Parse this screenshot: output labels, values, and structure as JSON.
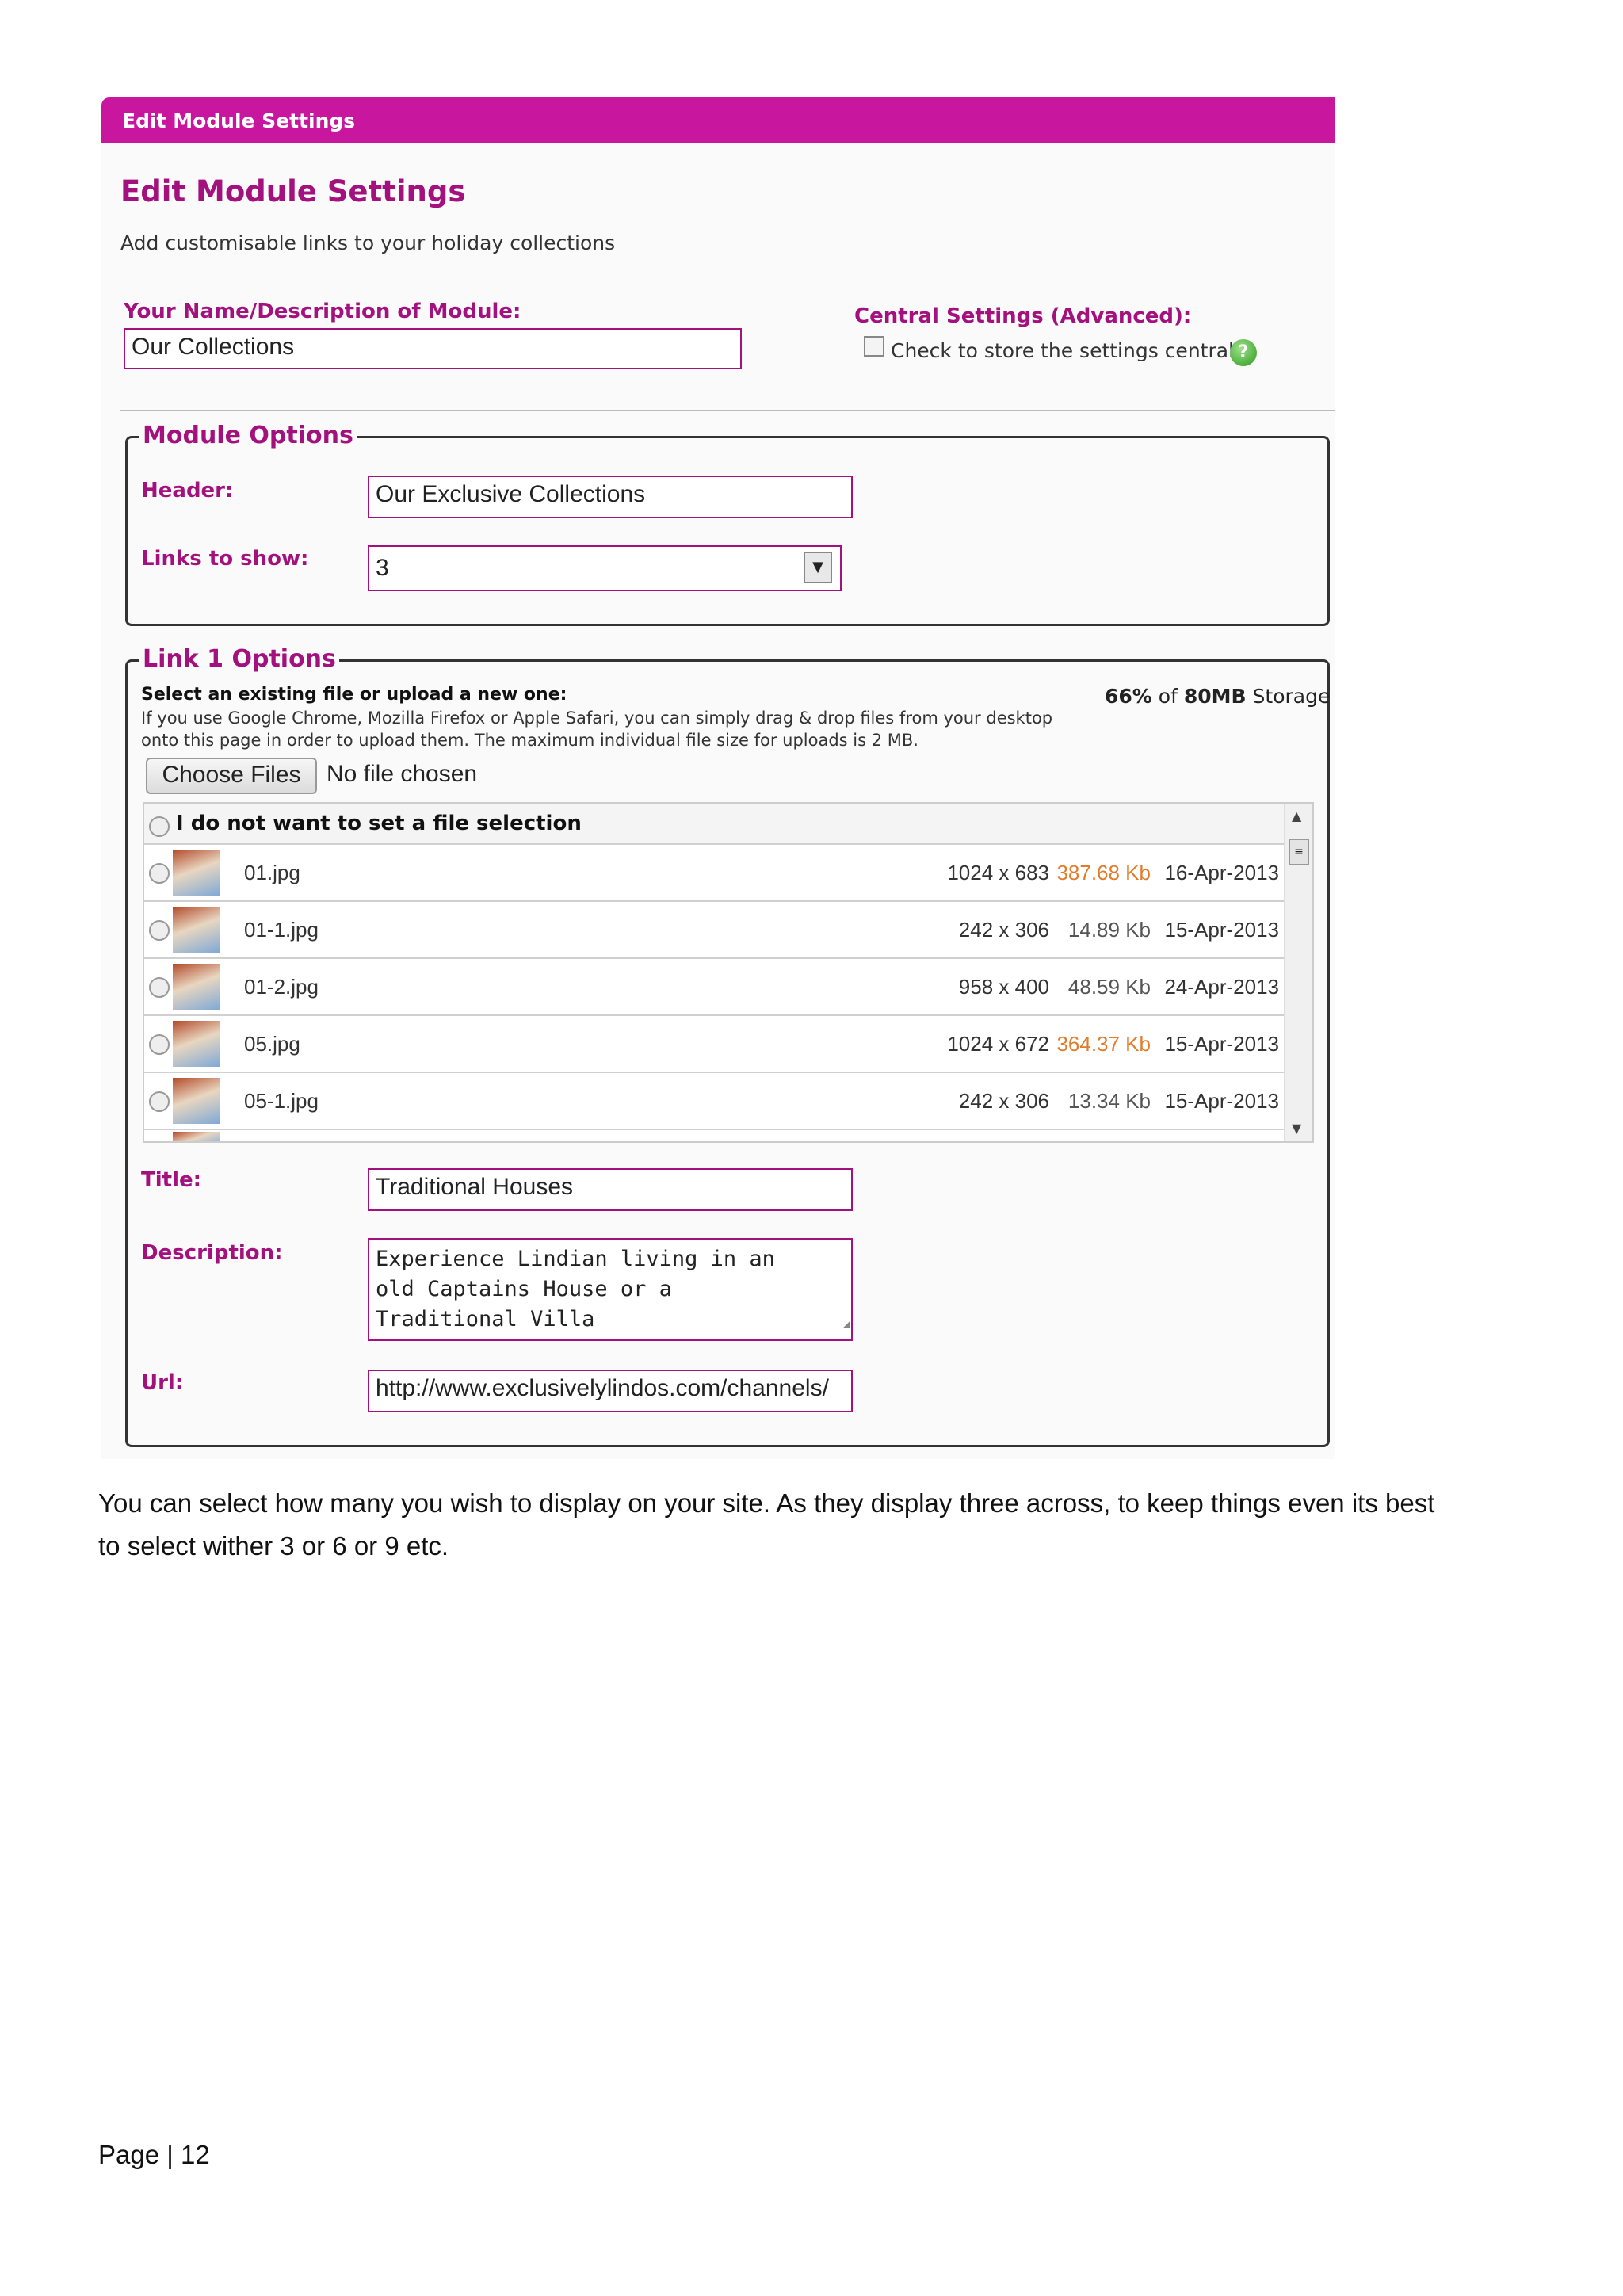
{
  "window": {
    "title": "Edit Module Settings"
  },
  "heading": "Edit Module Settings",
  "subtitle": "Add customisable links to your holiday collections",
  "module_name": {
    "label": "Your Name/Description of Module:",
    "value": "Our Collections"
  },
  "central_settings": {
    "label": "Central Settings (Advanced):",
    "checkbox_label": "Check to store the settings centrally",
    "checked": false
  },
  "module_options": {
    "legend": "Module Options",
    "header_label": "Header:",
    "header_value": "Our Exclusive Collections",
    "links_label": "Links to show:",
    "links_value": "3"
  },
  "link1": {
    "legend": "Link 1 Options",
    "select_title": "Select an existing file or upload a new one:",
    "select_help_1": "If you use Google Chrome, Mozilla Firefox or Apple Safari, you can simply drag & drop files from your desktop",
    "select_help_2": "onto this page in order to upload them. The maximum individual file size for uploads is 2 MB.",
    "storage_pct": "66%",
    "storage_of": "of",
    "storage_total": "80MB",
    "storage_word": "Storage",
    "choose_files": "Choose Files",
    "no_file": "No file chosen",
    "no_selection": "I do not want to set a file selection",
    "files": [
      {
        "name": "01.jpg",
        "dims": "1024 x 683",
        "size": "387.68 Kb",
        "date": "16-Apr-2013",
        "large": true
      },
      {
        "name": "01-1.jpg",
        "dims": "242 x 306",
        "size": "14.89 Kb",
        "date": "15-Apr-2013",
        "large": false
      },
      {
        "name": "01-2.jpg",
        "dims": "958 x 400",
        "size": "48.59 Kb",
        "date": "24-Apr-2013",
        "large": false
      },
      {
        "name": "05.jpg",
        "dims": "1024 x 672",
        "size": "364.37 Kb",
        "date": "15-Apr-2013",
        "large": true
      },
      {
        "name": "05-1.jpg",
        "dims": "242 x 306",
        "size": "13.34 Kb",
        "date": "15-Apr-2013",
        "large": false
      }
    ],
    "title_label": "Title:",
    "title_value": "Traditional Houses",
    "desc_label": "Description:",
    "desc_line1": "Experience Lindian living in an",
    "desc_line2": "old Captains House or a",
    "desc_line3": "Traditional Villa",
    "url_label": "Url:",
    "url_value": "http://www.exclusivelylindos.com/channels/"
  },
  "colors": {
    "accent": "#a3117f",
    "titlebar": "#c8169e",
    "size_large": "#e07c2c",
    "size_small": "#555555"
  },
  "paragraph_1": "You can select how many you wish to display on your site. As they display three across, to keep things even its best",
  "paragraph_2": "to select wither 3 or 6 or 9 etc.",
  "footer": {
    "page_word": "Page",
    "separator": "|",
    "page_number": "12"
  }
}
